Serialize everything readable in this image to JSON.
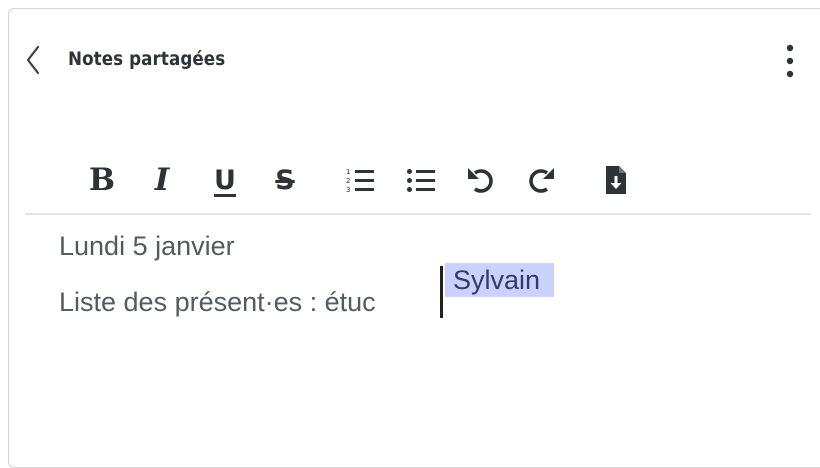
{
  "header": {
    "title": "Notes partagées"
  },
  "toolbar": {
    "bold_label": "B",
    "italic_label": "I",
    "underline_label": "U",
    "strikethrough_label": "S",
    "ordered_list_icon": "ordered-list-icon",
    "unordered_list_icon": "unordered-list-icon",
    "undo_icon": "undo-icon",
    "redo_icon": "redo-icon",
    "export_icon": "file-download-icon"
  },
  "editor": {
    "lines": [
      "Lundi 5 janvier",
      "Liste des présent·es : étuc"
    ],
    "remote_cursor": {
      "user": "Sylvain",
      "color": "#c8d2fa"
    }
  },
  "colors": {
    "text_primary": "#2f3336",
    "text_body": "#555a5e",
    "border": "#d3d3d3",
    "divider": "#e2e4e6",
    "cursor_highlight": "#c8d2fa"
  }
}
